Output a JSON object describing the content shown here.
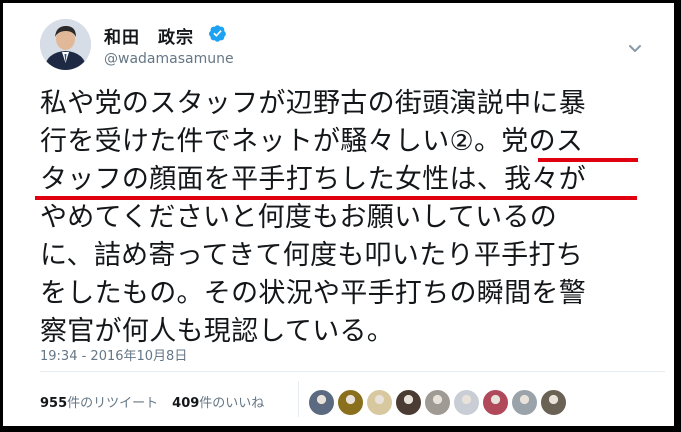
{
  "author": {
    "display_name": "和田　政宗",
    "handle": "@wadamasamune",
    "verified_icon": "verified-badge-icon",
    "verified_color": "#1da1f2"
  },
  "tweet": {
    "lines": [
      "私や党のスタッフが辺野古の街頭演説中に暴",
      "行を受けた件でネットが騒々しい②。党のス",
      "タッフの顔面を平手打ちした女性は、我々が",
      "やめてくださいと何度もお願いしているの",
      "に、詰め寄ってきて何度も叩いたり平手打ち",
      "をしたもの。その状況や平手打ちの瞬間を警",
      "察官が何人も現認している。"
    ],
    "underline_color": "#e0000f"
  },
  "timestamp": "19:34 - 2016年10月8日",
  "stats": {
    "retweets_count": "955",
    "retweets_label": "件のリツイート",
    "likes_count": "409",
    "likes_label": "件のいいね"
  },
  "likers": [
    {
      "icon": "liker-avatar-1",
      "color": "#5b6a80"
    },
    {
      "icon": "liker-avatar-2",
      "color": "#8a6f1c"
    },
    {
      "icon": "liker-avatar-3",
      "color": "#d8c8a0"
    },
    {
      "icon": "liker-avatar-4",
      "color": "#4a3b33"
    },
    {
      "icon": "liker-avatar-5",
      "color": "#a09a94"
    },
    {
      "icon": "liker-avatar-6",
      "color": "#c9ced6"
    },
    {
      "icon": "liker-avatar-7",
      "color": "#b04a5a"
    },
    {
      "icon": "liker-avatar-8",
      "color": "#9aa2aa"
    },
    {
      "icon": "liker-avatar-9",
      "color": "#6b6256"
    }
  ],
  "menu_icon": "chevron-down-icon"
}
